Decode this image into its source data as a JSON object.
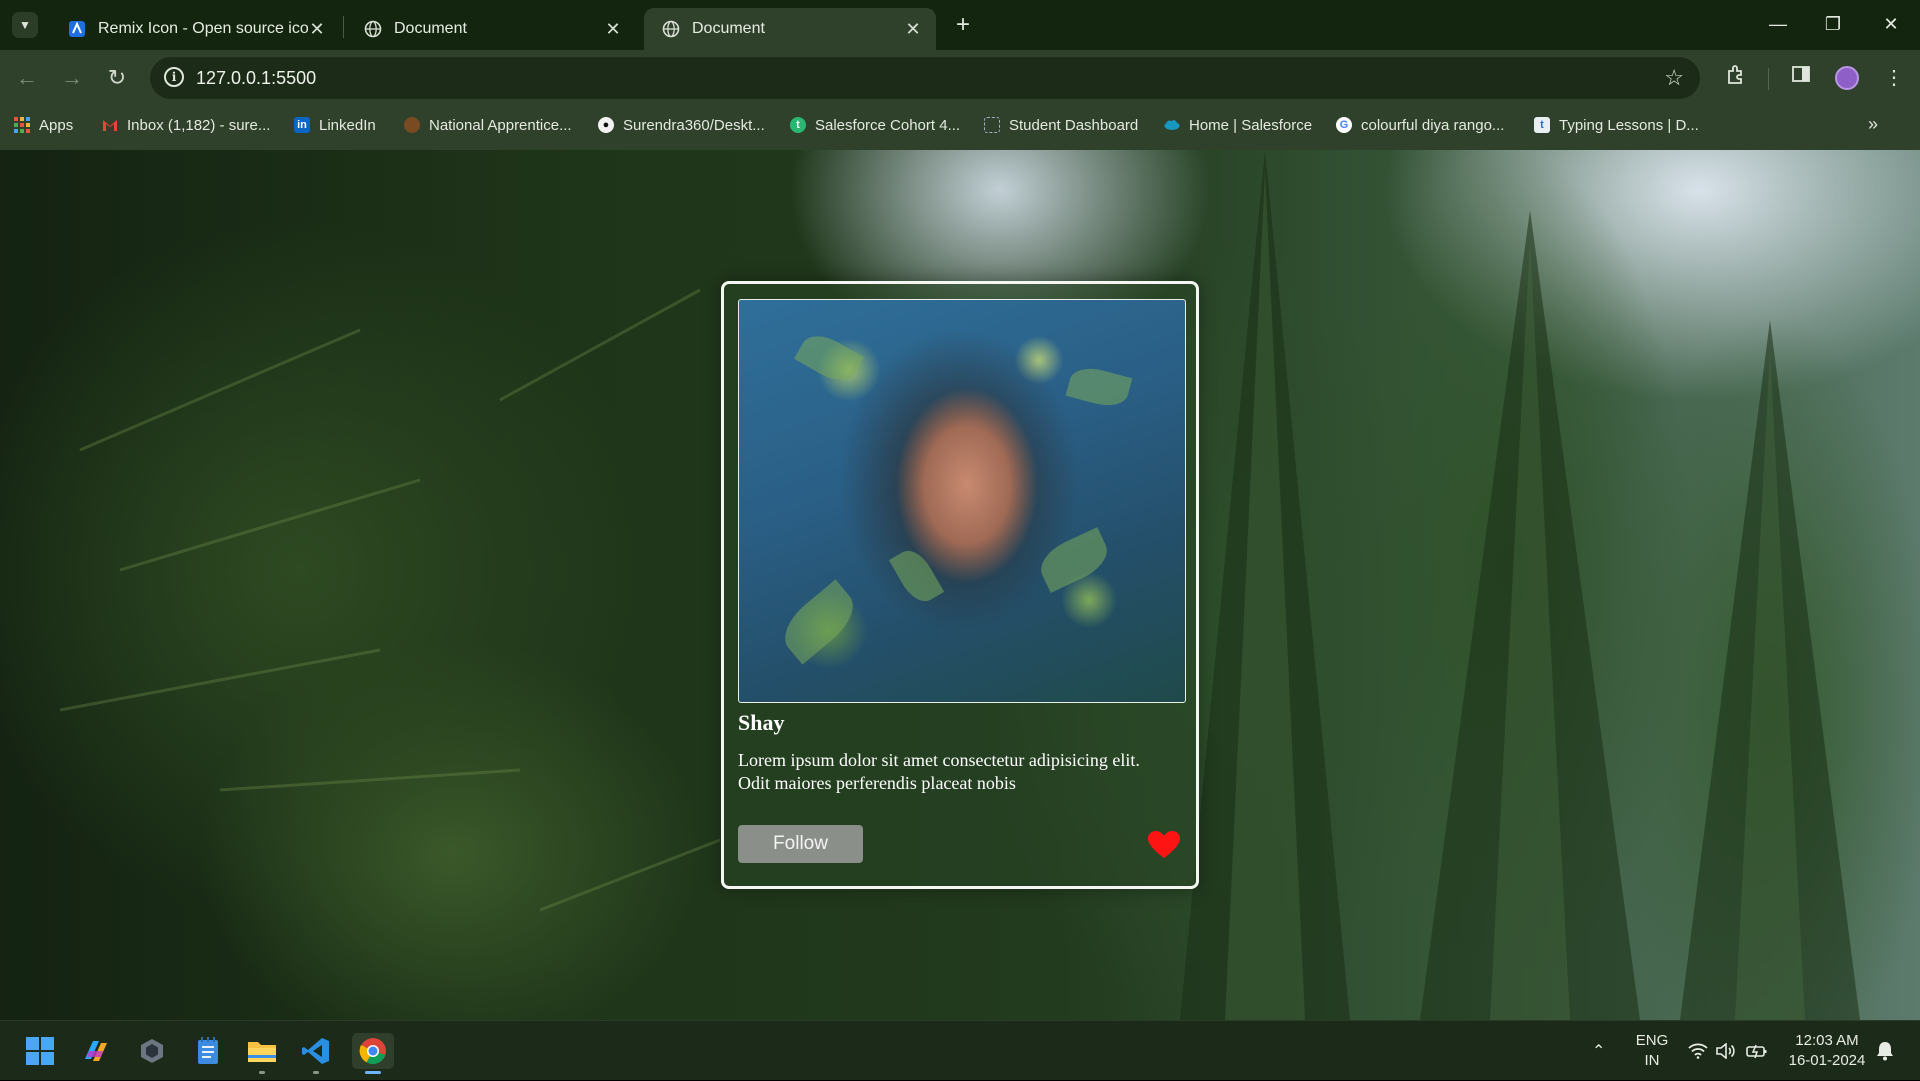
{
  "browser": {
    "tabs": [
      {
        "title": "Remix Icon - Open source icon l",
        "favicon": "remix-icon-favicon",
        "active": false
      },
      {
        "title": "Document",
        "favicon": "globe-icon",
        "active": false
      },
      {
        "title": "Document",
        "favicon": "globe-icon",
        "active": true
      }
    ],
    "url": "127.0.0.1:5500",
    "bookmarks": [
      {
        "label": "Apps",
        "icon": "apps-grid-icon"
      },
      {
        "label": "Inbox (1,182) - sure...",
        "icon": "gmail-icon"
      },
      {
        "label": "LinkedIn",
        "icon": "linkedin-icon"
      },
      {
        "label": "National Apprentice...",
        "icon": "apprentice-icon"
      },
      {
        "label": "Surendra360/Deskt...",
        "icon": "github-icon"
      },
      {
        "label": "Salesforce Cohort 4...",
        "icon": "trailhead-icon"
      },
      {
        "label": "Student Dashboard",
        "icon": "dashboard-icon"
      },
      {
        "label": "Home | Salesforce",
        "icon": "salesforce-cloud-icon"
      },
      {
        "label": "colourful diya rango...",
        "icon": "google-icon"
      },
      {
        "label": "Typing Lessons | D...",
        "icon": "typing-icon"
      }
    ]
  },
  "card": {
    "name": "Shay",
    "description": "Lorem ipsum dolor sit amet consectetur adipisicing elit. Odit maiores perferendis placeat nobis",
    "follow_label": "Follow",
    "photo": "portrait-photo",
    "like_icon": "heart-icon"
  },
  "taskbar": {
    "apps": [
      "start-icon",
      "copilot-icon",
      "widgets-icon",
      "notepad-icon",
      "file-explorer-icon",
      "vscode-icon",
      "chrome-icon"
    ],
    "language": {
      "line1": "ENG",
      "line2": "IN"
    },
    "time": "12:03 AM",
    "date": "16-01-2024"
  },
  "colors": {
    "accent_red": "#ff1414",
    "chrome_dark": "#13250f",
    "chrome_toolbar": "#2f402b"
  }
}
